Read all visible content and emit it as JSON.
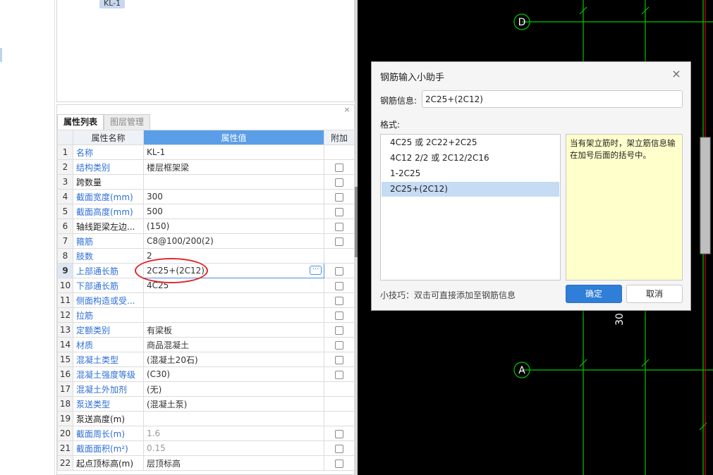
{
  "tree": {
    "selected_node": "KL-1"
  },
  "property_panel": {
    "close": "×",
    "tabs": [
      {
        "label": "属性列表"
      },
      {
        "label": "图层管理"
      }
    ],
    "columns": {
      "name": "属性名称",
      "value": "属性值",
      "extra": "附加"
    },
    "rows": [
      {
        "idx": "1",
        "name": "名称",
        "value": "KL-1",
        "blue": true,
        "checkbox": false
      },
      {
        "idx": "2",
        "name": "结构类别",
        "value": "楼层框架梁",
        "blue": true,
        "checkbox": true
      },
      {
        "idx": "3",
        "name": "跨数量",
        "value": "",
        "blue": false,
        "checkbox": true
      },
      {
        "idx": "4",
        "name": "截面宽度(mm)",
        "value": "300",
        "blue": true,
        "checkbox": true
      },
      {
        "idx": "5",
        "name": "截面高度(mm)",
        "value": "500",
        "blue": true,
        "checkbox": true
      },
      {
        "idx": "6",
        "name": "轴线距梁左边...",
        "value": "(150)",
        "blue": false,
        "checkbox": true
      },
      {
        "idx": "7",
        "name": "箍筋",
        "value": "C8@100/200(2)",
        "blue": true,
        "checkbox": true
      },
      {
        "idx": "8",
        "name": "肢数",
        "value": "2",
        "blue": true,
        "checkbox": false
      },
      {
        "idx": "9",
        "name": "上部通长筋",
        "value": "2C25+(2C12)",
        "blue": true,
        "checkbox": true,
        "selected": true
      },
      {
        "idx": "10",
        "name": "下部通长筋",
        "value": "4C25",
        "blue": true,
        "checkbox": true
      },
      {
        "idx": "11",
        "name": "侧面构造或受...",
        "value": "",
        "blue": true,
        "checkbox": true
      },
      {
        "idx": "12",
        "name": "拉筋",
        "value": "",
        "blue": true,
        "checkbox": true
      },
      {
        "idx": "13",
        "name": "定额类别",
        "value": "有梁板",
        "blue": true,
        "checkbox": true
      },
      {
        "idx": "14",
        "name": "材质",
        "value": "商品混凝土",
        "blue": true,
        "checkbox": true
      },
      {
        "idx": "15",
        "name": "混凝土类型",
        "value": "(混凝土20石)",
        "blue": true,
        "checkbox": true
      },
      {
        "idx": "16",
        "name": "混凝土强度等级",
        "value": "(C30)",
        "blue": true,
        "checkbox": true
      },
      {
        "idx": "17",
        "name": "混凝土外加剂",
        "value": "(无)",
        "blue": true,
        "checkbox": false
      },
      {
        "idx": "18",
        "name": "泵送类型",
        "value": "(混凝土泵)",
        "blue": true,
        "checkbox": false
      },
      {
        "idx": "19",
        "name": "泵送高度(m)",
        "value": "",
        "blue": false,
        "checkbox": false
      },
      {
        "idx": "20",
        "name": "截面周长(m)",
        "value": "1.6",
        "blue": true,
        "checkbox": true,
        "gray": true
      },
      {
        "idx": "21",
        "name": "截面面积(m²)",
        "value": "0.15",
        "blue": true,
        "checkbox": true,
        "gray": true
      },
      {
        "idx": "22",
        "name": "起点顶标高(m)",
        "value": "层顶标高",
        "blue": false,
        "checkbox": true
      }
    ]
  },
  "cad": {
    "axis_labels": [
      "D",
      "A"
    ],
    "dimension_text": "30"
  },
  "dialog": {
    "title": "钢筋输入小助手",
    "close": "×",
    "info_label": "钢筋信息:",
    "info_value": "2C25+(2C12)",
    "format_label": "格式:",
    "formats": [
      {
        "label": "4C25 或 2C22+2C25"
      },
      {
        "label": "4C12 2/2 或 2C12/2C16"
      },
      {
        "label": "1-2C25"
      },
      {
        "label": "2C25+(2C12)",
        "selected": true
      }
    ],
    "hint": "当有架立筋时，架立筋信息输在加号后面的括号中。",
    "tip": "小技巧：双击可直接添加至钢筋信息",
    "ok": "确定",
    "cancel": "取消"
  },
  "colors": {
    "accent": "#2f7ed8",
    "header_blue": "#5b9ee8",
    "cad_green": "#00c800",
    "cad_red": "#e00000",
    "highlight_red": "#e0262a",
    "hint_bg": "#ffffcc"
  }
}
